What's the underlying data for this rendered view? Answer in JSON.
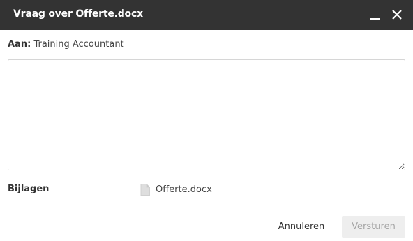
{
  "dialog": {
    "title": "Vraag over Offerte.docx",
    "minimize_icon": "minimize-icon",
    "close_icon": "close-icon"
  },
  "recipient": {
    "label": "Aan:",
    "value": "Training Accountant"
  },
  "message": {
    "value": "",
    "placeholder": ""
  },
  "attachments": {
    "label": "Bijlagen",
    "files": [
      {
        "name": "Offerte.docx",
        "icon": "document-icon"
      }
    ]
  },
  "footer": {
    "cancel_label": "Annuleren",
    "send_label": "Versturen",
    "send_disabled": true
  },
  "colors": {
    "titlebar_bg": "#333333",
    "title_text": "#ffffff",
    "send_disabled_bg": "#eeeeee",
    "send_disabled_text": "#a5a5a5"
  }
}
